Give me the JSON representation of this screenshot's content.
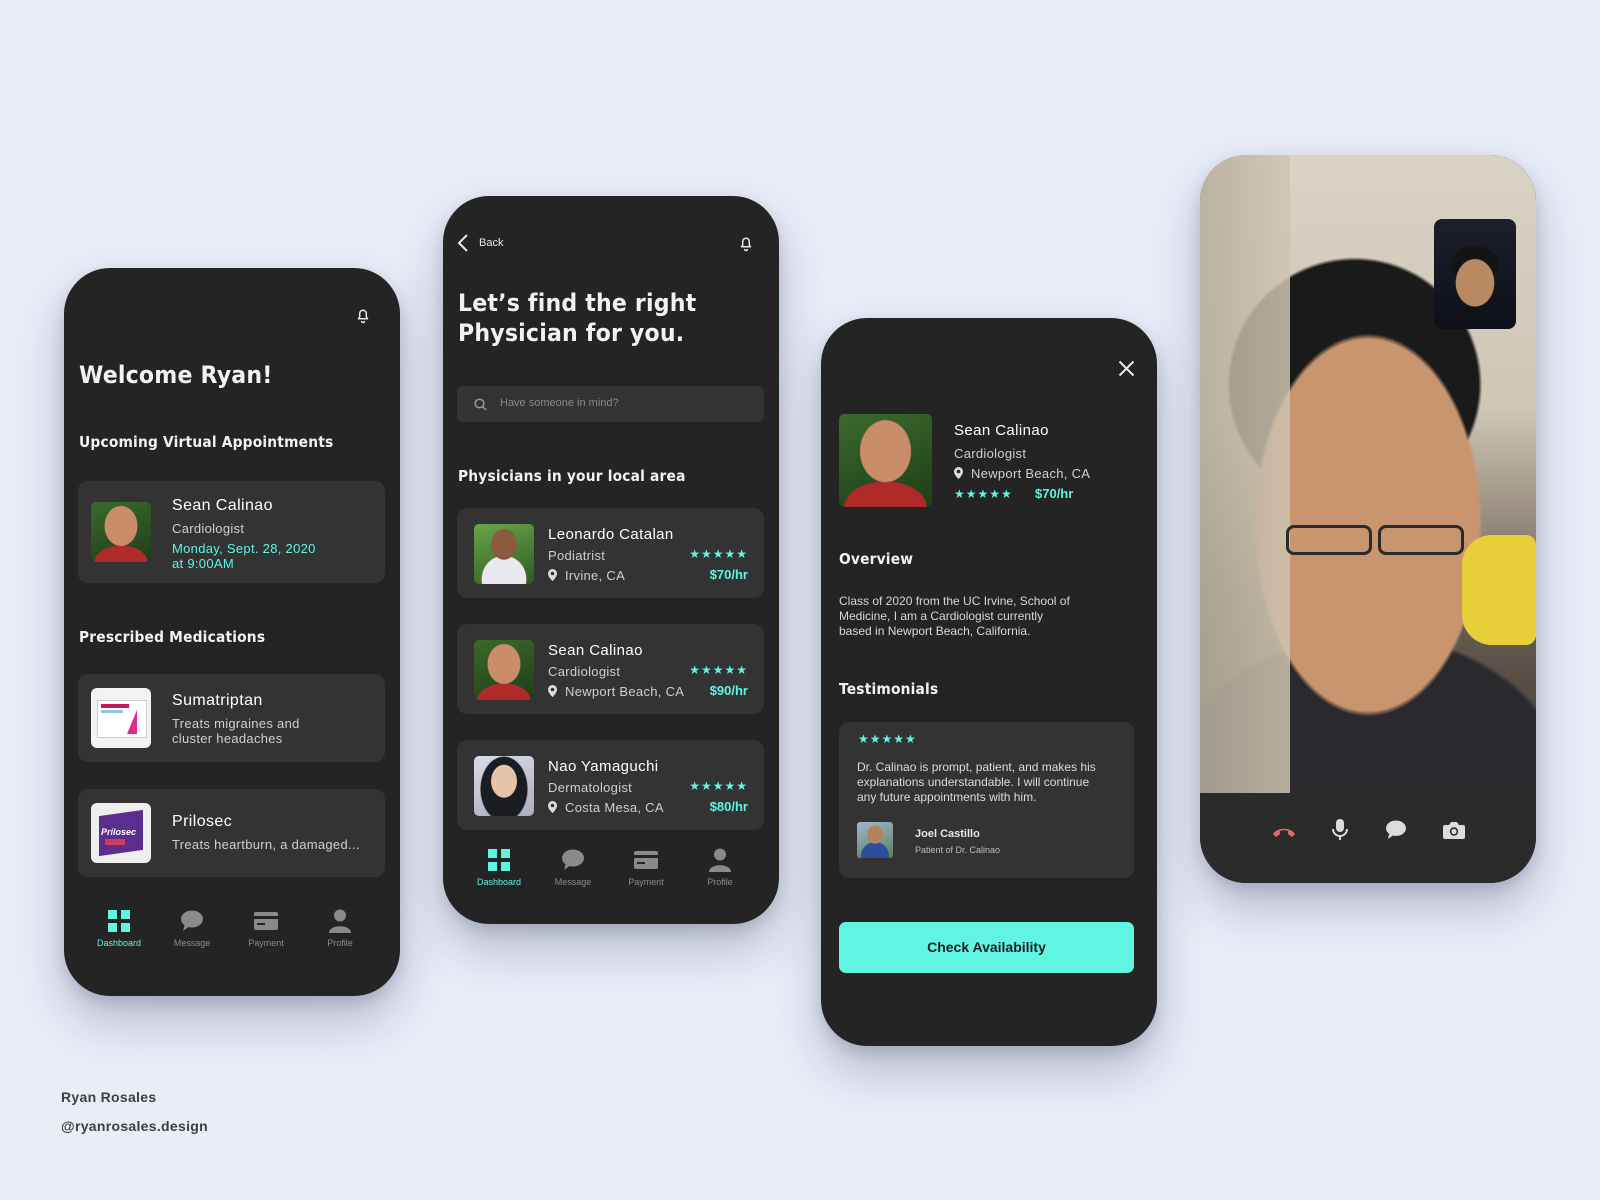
{
  "colors": {
    "background": "#e9edf8",
    "phone": "#242424",
    "card": "#333333",
    "accent": "#5ff5e2",
    "hangup": "#e06a6a"
  },
  "credits": {
    "name": "Ryan Rosales",
    "handle": "@ryanrosales.design"
  },
  "nav": {
    "dashboard": "Dashboard",
    "message": "Message",
    "payment": "Payment",
    "profile": "Profile"
  },
  "screen1": {
    "welcome": "Welcome Ryan!",
    "appointments_title": "Upcoming Virtual Appointments",
    "appointment": {
      "name": "Sean Calinao",
      "specialty": "Cardiologist",
      "date": "Monday, Sept. 28, 2020",
      "time": "at 9:00AM"
    },
    "medications_title": "Prescribed Medications",
    "medications": [
      {
        "name": "Sumatriptan",
        "line1": "Treats migraines and",
        "line2": "cluster headaches"
      },
      {
        "name": "Prilosec",
        "line1": "Treats heartburn, a damaged..."
      }
    ]
  },
  "screen2": {
    "back": "Back",
    "title_line1": "Let’s find the right",
    "title_line2": "Physician for you.",
    "search_placeholder": "Have someone in mind?",
    "section_title": "Physicians in your local area",
    "physicians": [
      {
        "name": "Leonardo Catalan",
        "specialty": "Podiatrist",
        "location": "Irvine, CA",
        "stars": "★★★★★",
        "rate": "$70/hr"
      },
      {
        "name": "Sean Calinao",
        "specialty": "Cardiologist",
        "location": "Newport Beach, CA",
        "stars": "★★★★★",
        "rate": "$90/hr"
      },
      {
        "name": "Nao Yamaguchi",
        "specialty": "Dermatologist",
        "location": "Costa Mesa, CA",
        "stars": "★★★★★",
        "rate": "$80/hr"
      }
    ]
  },
  "screen3": {
    "profile": {
      "name": "Sean Calinao",
      "specialty": "Cardiologist",
      "location": "Newport Beach, CA",
      "stars": "★★★★★",
      "rate": "$70/hr"
    },
    "overview_title": "Overview",
    "overview_line1": "Class of 2020 from the UC Irvine, School of",
    "overview_line2": "Medicine, I am a Cardiologist currently",
    "overview_line3": "based in Newport Beach, California.",
    "testimonials_title": "Testimonials",
    "testimonial": {
      "stars": "★★★★★",
      "line1": "Dr. Calinao is prompt, patient, and makes his",
      "line2": "explanations understandable. I will continue",
      "line3": "any future appointments with him.",
      "author": "Joel Castillo",
      "author_role": "Patient of Dr. Calinao"
    },
    "cta": "Check Availability"
  },
  "screen4": {
    "icons": [
      "hang-up-icon",
      "microphone-icon",
      "chat-bubble-icon",
      "camera-icon"
    ]
  }
}
